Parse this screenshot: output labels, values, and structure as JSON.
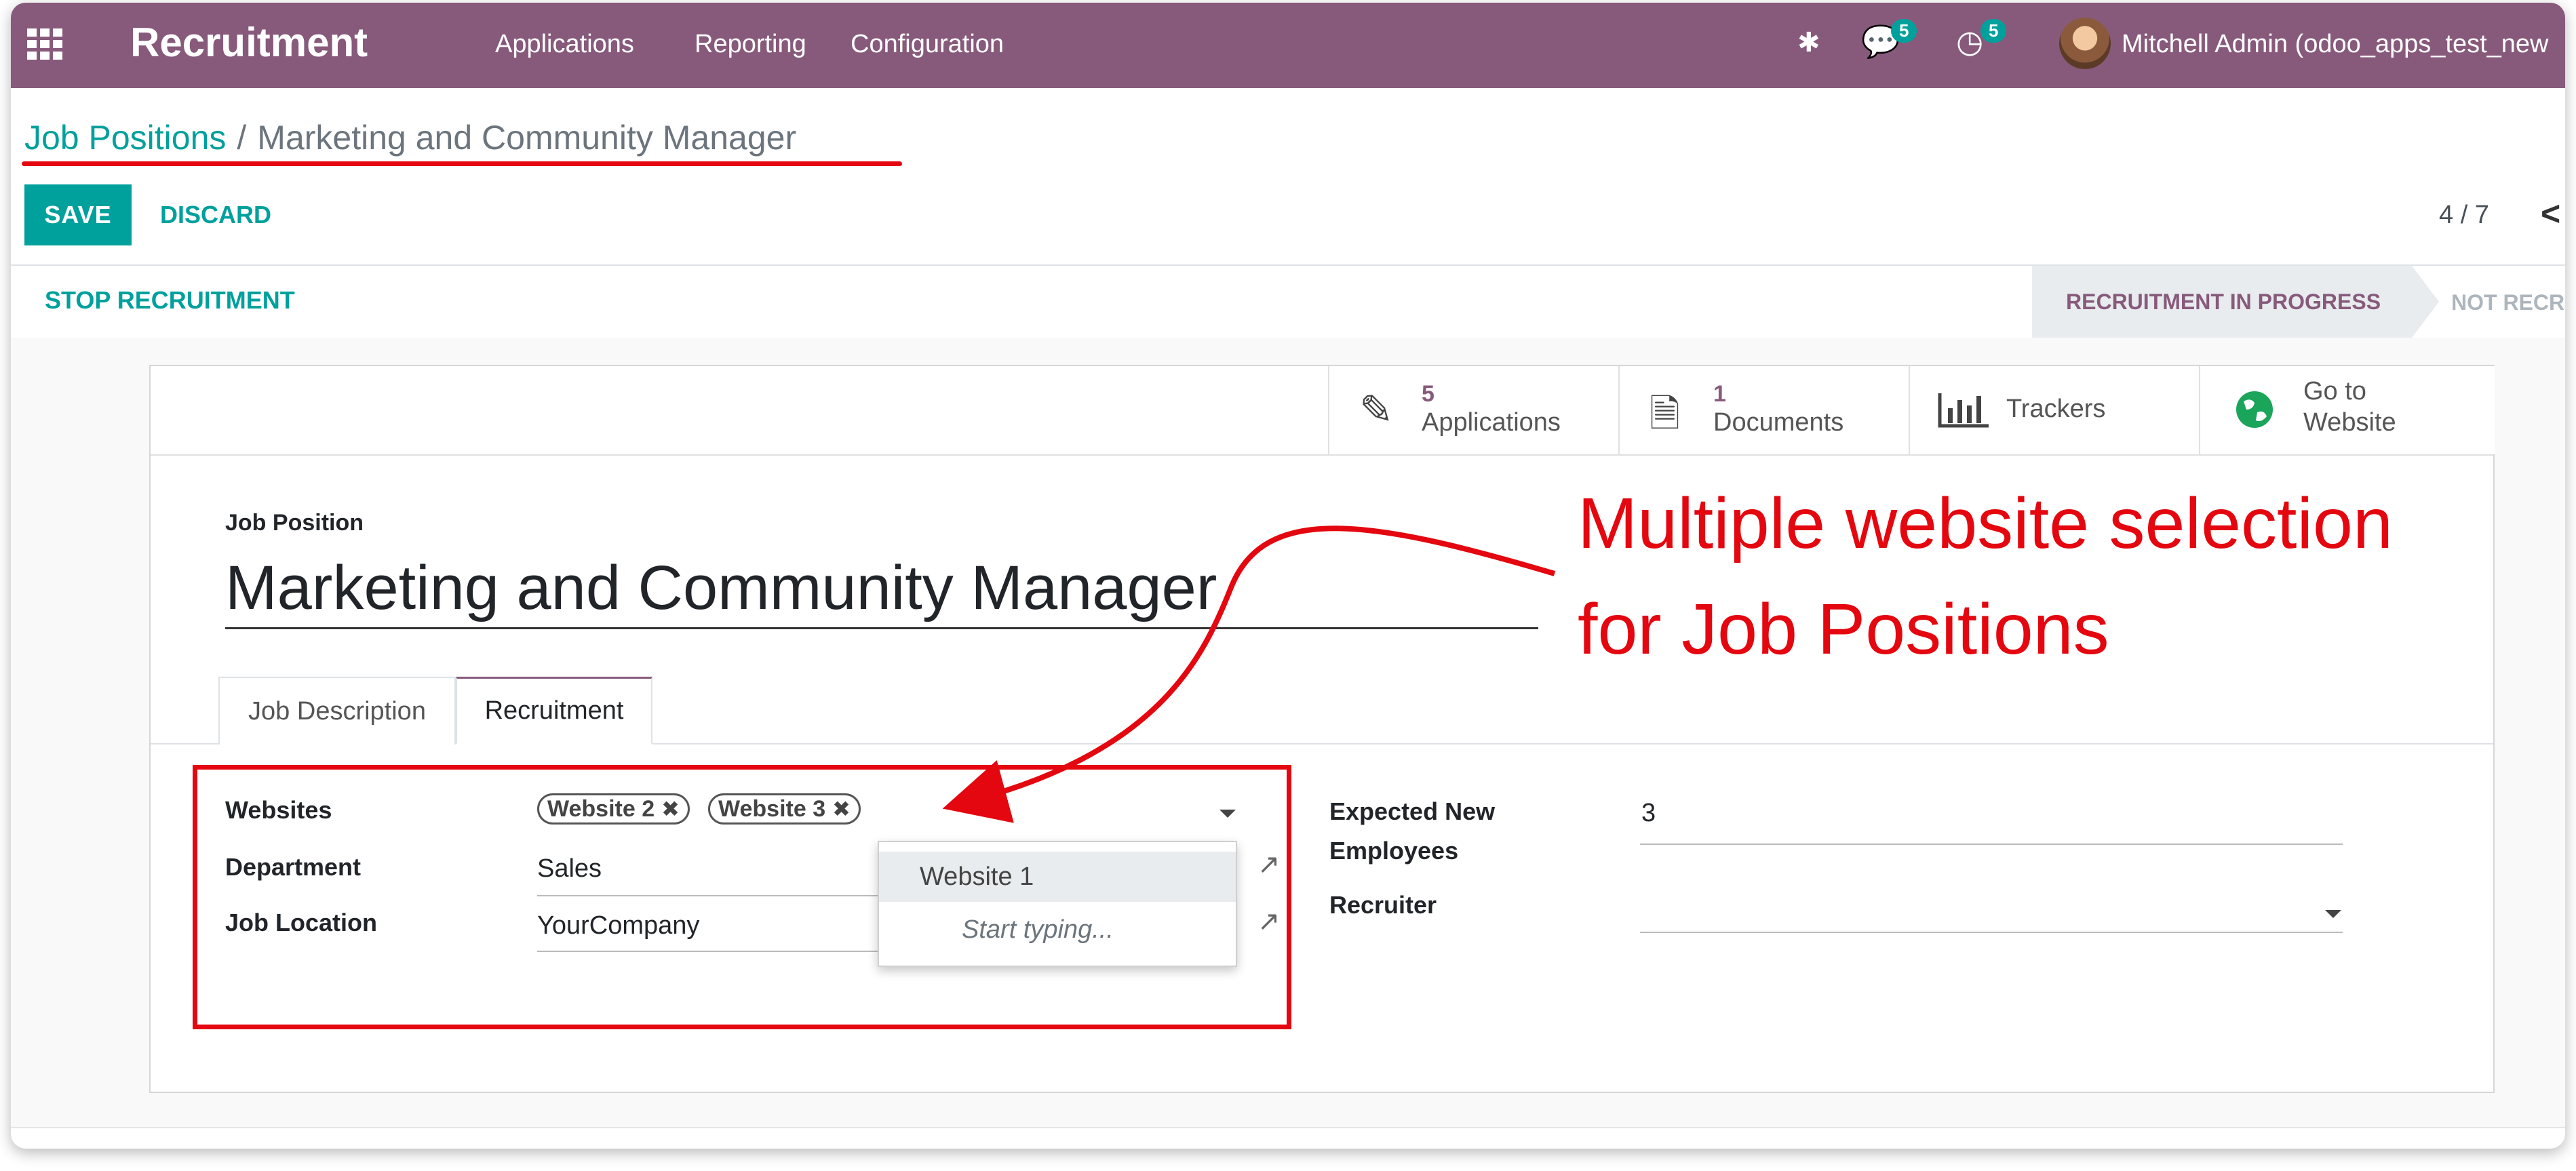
{
  "navbar": {
    "app_title": "Recruitment",
    "menu": [
      "Applications",
      "Reporting",
      "Configuration"
    ],
    "messages_count": "5",
    "activities_count": "5",
    "user_name": "Mitchell Admin (odoo_apps_test_new",
    "bg_color": "#875a7b"
  },
  "breadcrumb": {
    "parent": "Job Positions",
    "separator": "/",
    "current": "Marketing and Community Manager"
  },
  "actions": {
    "save": "SAVE",
    "discard": "DISCARD"
  },
  "pager": {
    "value": "4 / 7",
    "prev": "<"
  },
  "statusbar": {
    "stop_button": "STOP RECRUITMENT",
    "active_stage": "RECRUITMENT IN PROGRESS",
    "next_stage": "NOT RECRUIT"
  },
  "stat_buttons": {
    "applications": {
      "value": "5",
      "label": "Applications"
    },
    "documents": {
      "value": "1",
      "label": "Documents"
    },
    "trackers": {
      "label": "Trackers"
    },
    "website": {
      "line1": "Go to",
      "line2": "Website"
    }
  },
  "form": {
    "title_caption": "Job Position",
    "title_value": "Marketing and Community Manager",
    "tabs": [
      "Job Description",
      "Recruitment"
    ],
    "websites_label": "Websites",
    "website_tags": [
      "Website 2",
      "Website 3"
    ],
    "tag_remove_glyph": "✖",
    "department_label": "Department",
    "department_value": "Sales",
    "job_location_label": "Job Location",
    "job_location_value": "YourCompany",
    "expected_label_line1": "Expected New",
    "expected_label_line2": "Employees",
    "expected_value": "3",
    "recruiter_label": "Recruiter",
    "recruiter_value": ""
  },
  "dropdown": {
    "options": [
      "Website 1"
    ],
    "hint": "Start typing..."
  },
  "annotation": {
    "line1": "Multiple website selection",
    "line2": "for Job Positions",
    "color": "#e4070f"
  },
  "colors": {
    "primary": "#00a09d",
    "brand": "#875a7b",
    "annotation": "#e4070f"
  }
}
